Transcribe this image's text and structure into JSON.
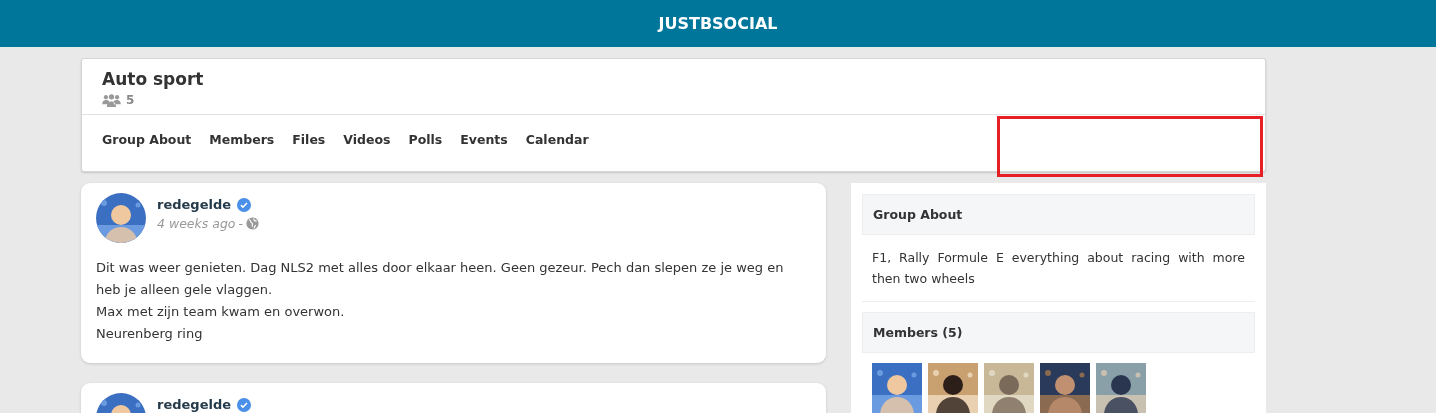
{
  "site": {
    "title": "JUSTBSOCIAL"
  },
  "group": {
    "name": "Auto sport",
    "member_count": "5",
    "tabs": [
      {
        "label": "Group About",
        "selected": false
      },
      {
        "label": "Members",
        "selected": false
      },
      {
        "label": "Files",
        "selected": false
      },
      {
        "label": "Videos",
        "selected": false
      },
      {
        "label": "Polls",
        "selected": false
      },
      {
        "label": "Events",
        "selected": false
      },
      {
        "label": "Calendar",
        "selected": false
      }
    ],
    "highlight": {
      "kind": "frame"
    }
  },
  "posts": [
    {
      "author": "redegelde",
      "verified": true,
      "time": "4 weeks ago",
      "separator": "-",
      "lines": [
        "Dit was weer genieten. Dag NLS2 met alles door elkaar heen. Geen gezeur. Pech dan slepen ze je weg en heb je alleen gele vlaggen.",
        "Max met zijn team kwam en overwon.",
        "Neurenberg ring"
      ]
    },
    {
      "author": "redegelde",
      "verified": true
    }
  ],
  "sidebar": {
    "about": {
      "title": "Group About",
      "text": "F1, Rally Formule E everything about racing with more then two wheels"
    },
    "members": {
      "title": "Members (5)"
    }
  }
}
